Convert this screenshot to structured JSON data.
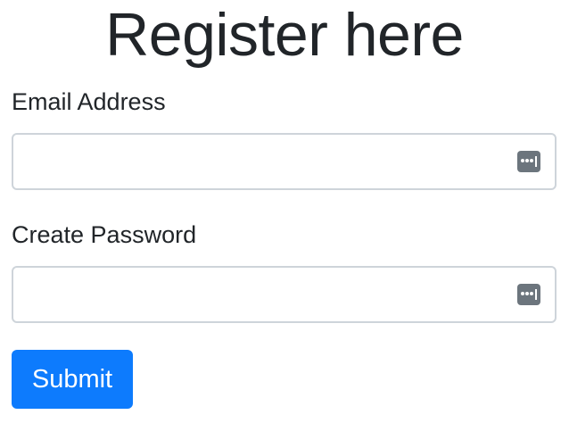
{
  "page": {
    "title": "Register here"
  },
  "form": {
    "email": {
      "label": "Email Address",
      "value": "",
      "placeholder": "",
      "icon": "password-manager-key-icon"
    },
    "password": {
      "label": "Create Password",
      "value": "",
      "placeholder": "",
      "icon": "password-manager-key-icon"
    },
    "submit_label": "Submit"
  },
  "colors": {
    "text": "#212529",
    "input_border": "#ced4da",
    "icon_fill": "#6c757d",
    "primary_button": "#0d7bfd",
    "button_text": "#ffffff",
    "background": "#ffffff"
  }
}
